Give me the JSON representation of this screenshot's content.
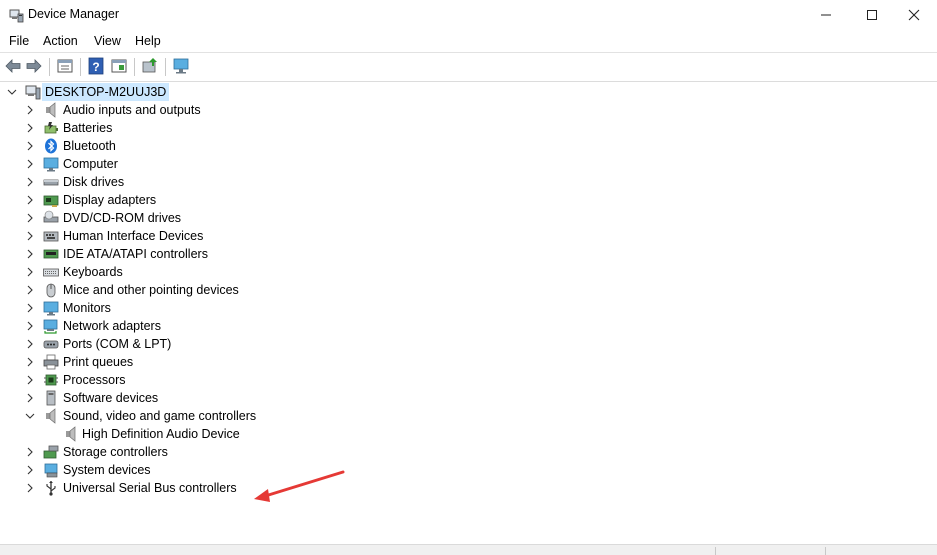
{
  "window": {
    "title": "Device Manager",
    "minimize_glyph": "—",
    "maximize_glyph": "☐",
    "close_glyph": "✕"
  },
  "menu": {
    "items": [
      "File",
      "Action",
      "View",
      "Help"
    ]
  },
  "toolbar": {
    "buttons": [
      "back-arrow-icon",
      "forward-arrow-icon",
      "properties-icon",
      "help-icon",
      "show-hidden-icon",
      "update-driver-icon",
      "scan-hardware-icon"
    ]
  },
  "tree": {
    "root": "DESKTOP-M2UUJ3D",
    "categories": [
      {
        "label": "Audio inputs and outputs",
        "icon": "speaker-icon"
      },
      {
        "label": "Batteries",
        "icon": "battery-icon"
      },
      {
        "label": "Bluetooth",
        "icon": "bluetooth-icon"
      },
      {
        "label": "Computer",
        "icon": "monitor-icon"
      },
      {
        "label": "Disk drives",
        "icon": "disk-drive-icon"
      },
      {
        "label": "Display adapters",
        "icon": "display-adapter-icon"
      },
      {
        "label": "DVD/CD-ROM drives",
        "icon": "dvd-drive-icon"
      },
      {
        "label": "Human Interface Devices",
        "icon": "hid-icon"
      },
      {
        "label": "IDE ATA/ATAPI controllers",
        "icon": "ide-controller-icon"
      },
      {
        "label": "Keyboards",
        "icon": "keyboard-icon"
      },
      {
        "label": "Mice and other pointing devices",
        "icon": "mouse-icon"
      },
      {
        "label": "Monitors",
        "icon": "monitor-icon"
      },
      {
        "label": "Network adapters",
        "icon": "network-adapter-icon"
      },
      {
        "label": "Ports (COM & LPT)",
        "icon": "port-icon"
      },
      {
        "label": "Print queues",
        "icon": "printer-icon"
      },
      {
        "label": "Processors",
        "icon": "processor-icon"
      },
      {
        "label": "Software devices",
        "icon": "software-device-icon"
      },
      {
        "label": "Sound, video and game controllers",
        "icon": "speaker-icon",
        "expanded": true
      },
      {
        "label": "High Definition Audio Device",
        "icon": "speaker-icon",
        "child": true
      },
      {
        "label": "Storage controllers",
        "icon": "storage-controller-icon"
      },
      {
        "label": "System devices",
        "icon": "system-device-icon"
      },
      {
        "label": "Universal Serial Bus controllers",
        "icon": "usb-icon"
      }
    ]
  },
  "annotation": {
    "color": "#e53935",
    "target": "Sound, video and game controllers"
  }
}
